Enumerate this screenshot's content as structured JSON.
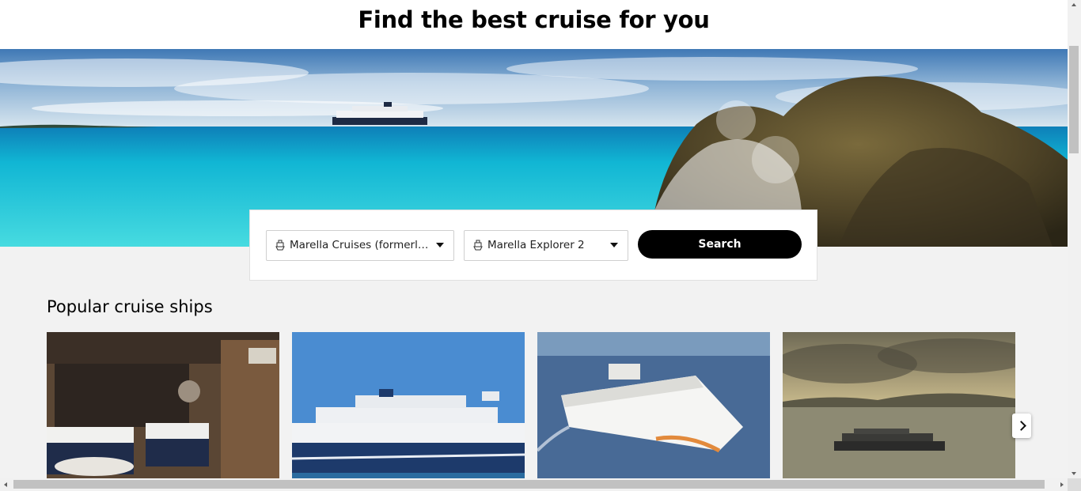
{
  "header": {
    "title": "Find the best cruise for you"
  },
  "search": {
    "cruise_line": {
      "value": "Marella Cruises (formerly Thomson Cruises)",
      "icon": "ship-icon"
    },
    "ship": {
      "value": "Marella Explorer 2",
      "icon": "ship-icon"
    },
    "button_label": "Search"
  },
  "popular": {
    "title": "Popular cruise ships",
    "cards": [
      {
        "image": "ship-cabin-interior"
      },
      {
        "image": "marella-ship-at-port"
      },
      {
        "image": "norwegian-ship-at-sea"
      },
      {
        "image": "ship-at-sunset"
      }
    ],
    "next_icon": "chevron-right-icon"
  },
  "colors": {
    "accent": "#000000",
    "page_bg": "#f2f2f2",
    "header_bg": "#ffffff"
  }
}
